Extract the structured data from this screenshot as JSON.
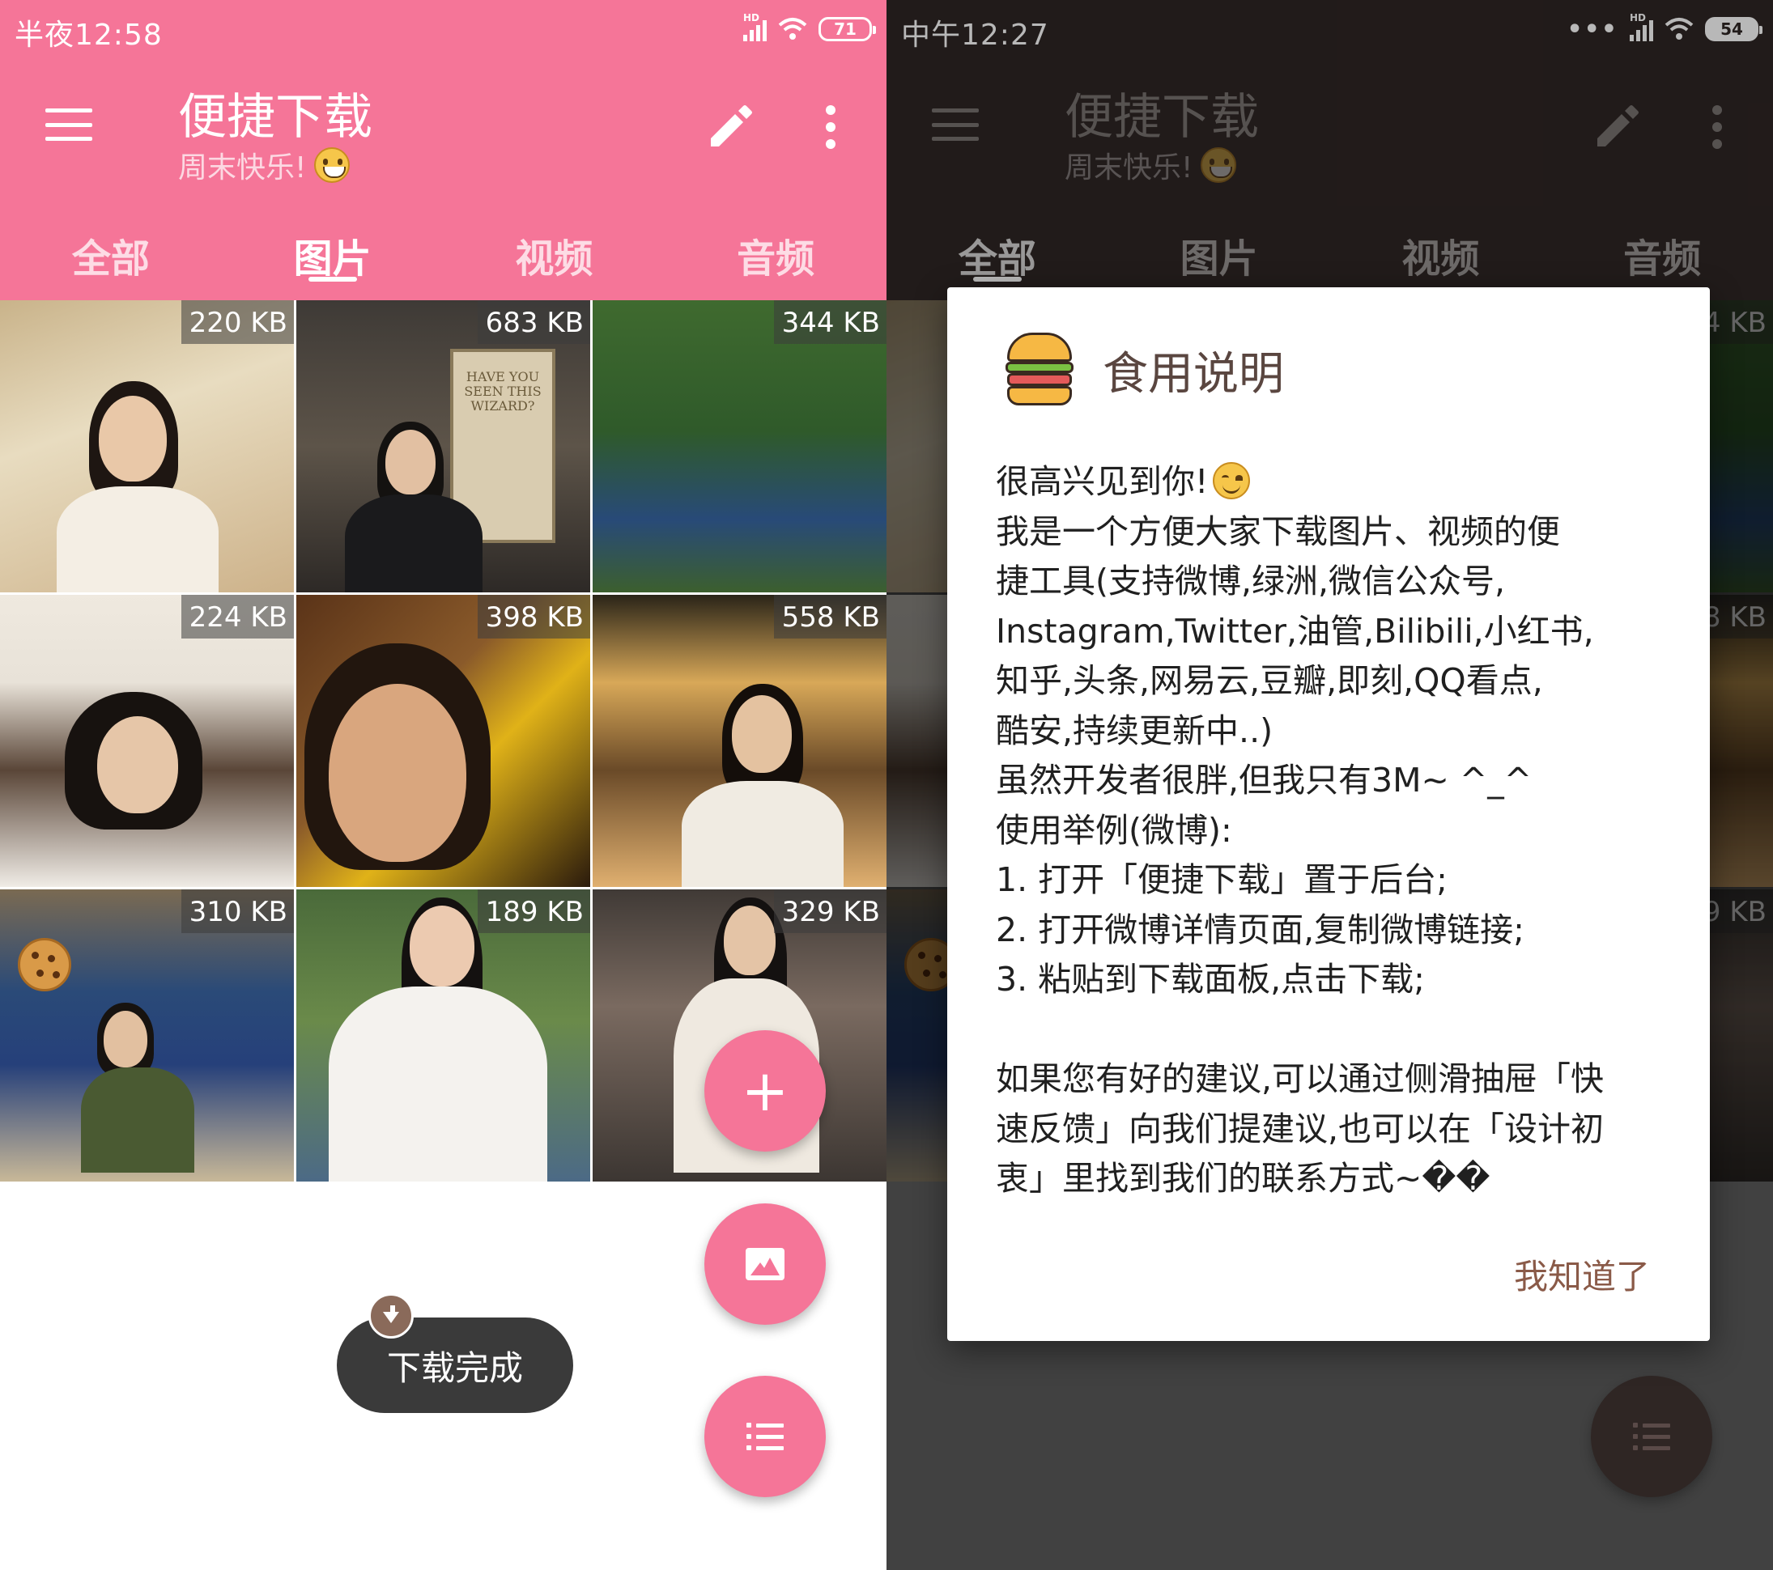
{
  "left": {
    "status": {
      "time": "半夜12:58",
      "battery": "71"
    },
    "header": {
      "title": "便捷下载",
      "subtitle": "周末快乐!"
    },
    "tabs": [
      {
        "label": "全部",
        "active": false
      },
      {
        "label": "图片",
        "active": true
      },
      {
        "label": "视频",
        "active": false
      },
      {
        "label": "音频",
        "active": false
      }
    ],
    "photos": [
      {
        "size": "220 KB"
      },
      {
        "size": "683 KB",
        "poster_text": "HAVE YOU SEEN THIS WIZARD?"
      },
      {
        "size": "344 KB"
      },
      {
        "size": "224 KB"
      },
      {
        "size": "398 KB"
      },
      {
        "size": "558 KB"
      },
      {
        "size": "310 KB"
      },
      {
        "size": "189 KB"
      },
      {
        "size": "329 KB"
      }
    ],
    "fabs": {
      "add": "+"
    },
    "toast": {
      "text": "下载完成"
    }
  },
  "right": {
    "status": {
      "time": "中午12:27",
      "battery": "54"
    },
    "header": {
      "title": "便捷下载",
      "subtitle": "周末快乐!"
    },
    "tabs": [
      {
        "label": "全部",
        "active": true
      },
      {
        "label": "图片",
        "active": false
      },
      {
        "label": "视频",
        "active": false
      },
      {
        "label": "音频",
        "active": false
      }
    ],
    "dialog": {
      "title": "食用说明",
      "lines": [
        "很高兴见到你!",
        "我是一个方便大家下载图片、视频的便",
        "捷工具(支持微博,绿洲,微信公众号,",
        "Instagram,Twitter,油管,Bilibili,小红书,",
        "知乎,头条,网易云,豆瓣,即刻,QQ看点,",
        "酷安,持续更新中..)",
        "虽然开发者很胖,但我只有3M~ ^_^",
        "使用举例(微博):",
        "1. 打开「便捷下载」置于后台;",
        "2. 打开微博详情页面,复制微博链接;",
        "3. 粘贴到下载面板,点击下载;",
        "",
        "如果您有好的建议,可以通过侧滑抽屉「快",
        "速反馈」向我们提建议,也可以在「设计初",
        "衷」里找到我们的联系方式~��"
      ],
      "action": "我知道了"
    }
  },
  "colors": {
    "accent": "#f57598",
    "dark_bar": "#2f2624",
    "action_text": "#8a5a48"
  }
}
